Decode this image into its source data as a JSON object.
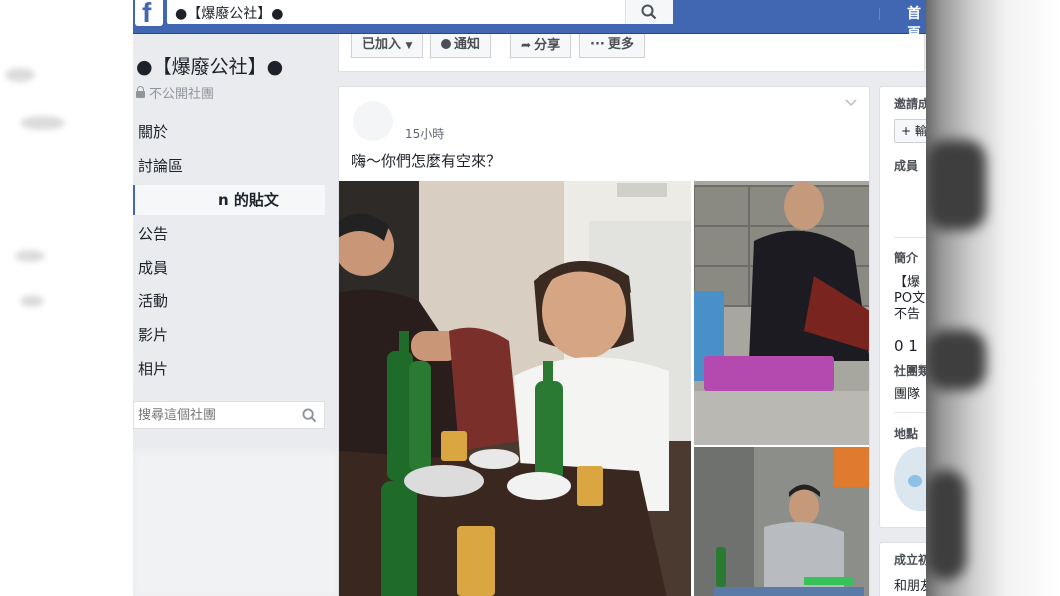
{
  "topbar": {
    "logo": "f",
    "search_query": "●【爆廢公社】●",
    "home_label": "首頁"
  },
  "group": {
    "name": "●【爆廢公社】●",
    "privacy": "不公開社團"
  },
  "nav": {
    "items": [
      "關於",
      "討論區",
      "的貼文",
      "公告",
      "成員",
      "活動",
      "影片",
      "相片"
    ],
    "active_suffix": "n 的貼文"
  },
  "group_search": {
    "placeholder": "搜尋這個社團"
  },
  "actions": {
    "joined": "已加入",
    "notify": "通知",
    "share": "分享",
    "more": "更多"
  },
  "post": {
    "time": "15小時",
    "text": "嗨～你們怎麼有空來？"
  },
  "right": {
    "invite_title": "邀請成",
    "invite_button": "+ 輸",
    "members_title": "成員",
    "about_title": "簡介",
    "about_line1": "【爆",
    "about_line2": "PO文",
    "about_line3": "不告",
    "number": "0 1",
    "type_title": "社團類",
    "type_value": "團隊",
    "location_title": "地點",
    "created_title": "成立初",
    "created_value": "和朋友"
  },
  "colors": {
    "fb_blue": "#4267b2",
    "background": "#e9ebee",
    "card": "#ffffff",
    "text_secondary": "#90949c"
  }
}
